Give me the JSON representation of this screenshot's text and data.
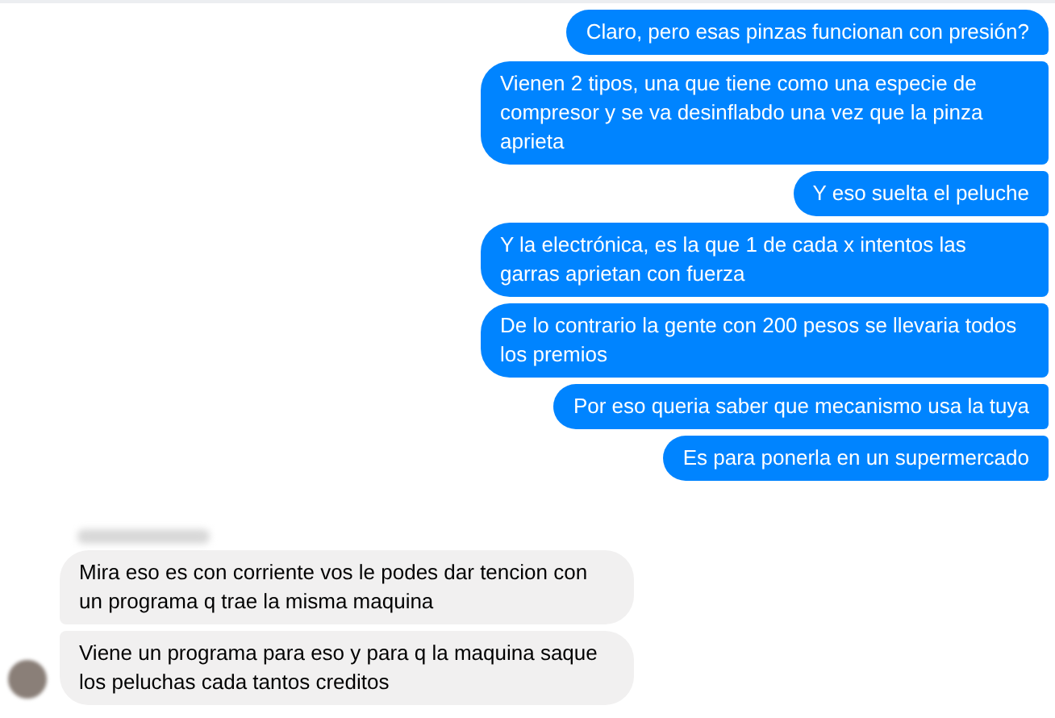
{
  "messages": [
    {
      "kind": "sent",
      "text": "Claro, pero esas pinzas funcionan con presión?"
    },
    {
      "kind": "sent",
      "text": "Vienen 2 tipos, una que tiene como una especie de compresor y se va desinflabdo una vez que la pinza aprieta"
    },
    {
      "kind": "sent",
      "text": "Y eso suelta el peluche"
    },
    {
      "kind": "sent",
      "text": "Y la electrónica, es la que 1 de cada x intentos las garras aprietan con fuerza"
    },
    {
      "kind": "sent",
      "text": "De lo contrario la gente con 200 pesos se llevaria todos los premios"
    },
    {
      "kind": "sent",
      "text": "Por eso queria saber que mecanismo usa la tuya"
    },
    {
      "kind": "sent",
      "text": "Es para ponerla en un supermercado"
    },
    {
      "kind": "received",
      "text": "Mira eso es con corriente vos le podes dar tencion con un programa q trae la misma maquina"
    },
    {
      "kind": "received",
      "text": "Viene un programa para eso y para q la maquina saque los peluchas cada tantos creditos"
    }
  ]
}
